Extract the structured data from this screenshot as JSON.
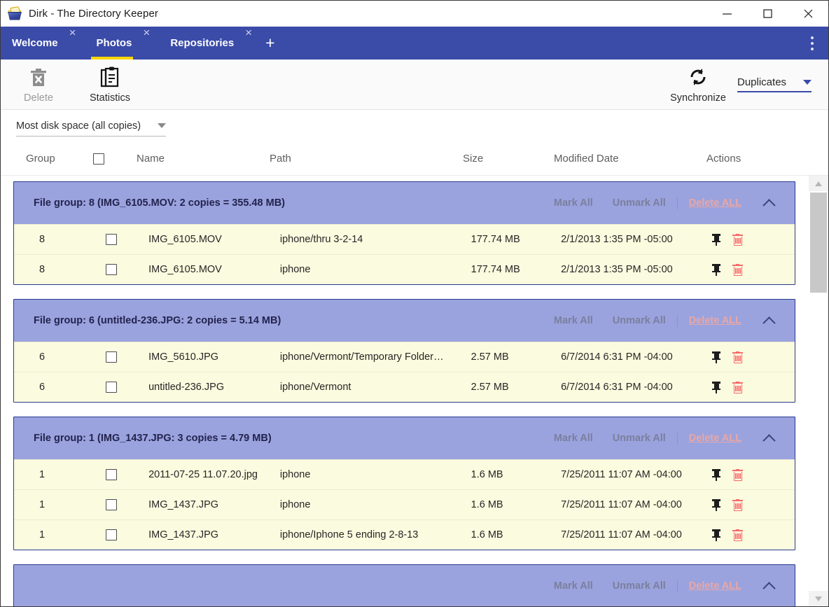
{
  "window": {
    "title": "Dirk - The Directory Keeper",
    "app_icon": "basket-icon",
    "controls": {
      "minimize": "minimize-icon",
      "maximize": "maximize-icon",
      "close": "close-icon"
    }
  },
  "tabs": {
    "items": [
      {
        "label": "Welcome",
        "active": false,
        "close": "×"
      },
      {
        "label": "Photos",
        "active": true,
        "close": "×"
      },
      {
        "label": "Repositories",
        "active": false,
        "close": "×"
      }
    ],
    "add_label": "+",
    "overflow_menu": "kebab-menu-icon",
    "active_underline_color": "#ffd600",
    "bar_color": "#3a4ba8"
  },
  "toolbar": {
    "delete_label": "Delete",
    "delete_icon": "trash-icon",
    "delete_disabled": true,
    "statistics_label": "Statistics",
    "statistics_icon": "clipboard-icon",
    "synchronize_label": "Synchronize",
    "synchronize_icon": "refresh-icon",
    "view_dropdown": {
      "value": "Duplicates",
      "caret": "chevron-down-icon",
      "accent": "#3a4ba8"
    }
  },
  "sort": {
    "value": "Most disk space (all copies)",
    "caret": "chevron-down-icon"
  },
  "table": {
    "columns": [
      "Group",
      "",
      "Name",
      "Path",
      "Size",
      "Modified Date",
      "Actions"
    ],
    "select_all_checkbox": "checkbox-unchecked"
  },
  "group_actions": {
    "mark_all": "Mark All",
    "unmark_all": "Unmark All",
    "delete_all": "Delete ALL",
    "collapse_icon": "chevron-up-icon"
  },
  "row_actions": {
    "pin": "pin-icon",
    "delete": "trash-icon"
  },
  "groups": [
    {
      "header": "File group: 8 (IMG_6105.MOV: 2 copies = 355.48 MB)",
      "rows": [
        {
          "group": "8",
          "checked": false,
          "name": "IMG_6105.MOV",
          "path": "iphone/thru 3-2-14",
          "size": "177.74 MB",
          "modified": "2/1/2013 1:35 PM -05:00"
        },
        {
          "group": "8",
          "checked": false,
          "name": "IMG_6105.MOV",
          "path": "iphone",
          "size": "177.74 MB",
          "modified": "2/1/2013 1:35 PM -05:00"
        }
      ]
    },
    {
      "header": "File group: 6 (untitled-236.JPG: 2 copies = 5.14 MB)",
      "rows": [
        {
          "group": "6",
          "checked": false,
          "name": "IMG_5610.JPG",
          "path": "iphone/Vermont/Temporary Folder…",
          "size": "2.57 MB",
          "modified": "6/7/2014 6:31 PM -04:00"
        },
        {
          "group": "6",
          "checked": false,
          "name": "untitled-236.JPG",
          "path": "iphone/Vermont",
          "size": "2.57 MB",
          "modified": "6/7/2014 6:31 PM -04:00"
        }
      ]
    },
    {
      "header": "File group: 1 (IMG_1437.JPG: 3 copies = 4.79 MB)",
      "rows": [
        {
          "group": "1",
          "checked": false,
          "name": "2011-07-25 11.07.20.jpg",
          "path": "iphone",
          "size": "1.6 MB",
          "modified": "7/25/2011 11:07 AM -04:00"
        },
        {
          "group": "1",
          "checked": false,
          "name": "IMG_1437.JPG",
          "path": "iphone",
          "size": "1.6 MB",
          "modified": "7/25/2011 11:07 AM -04:00"
        },
        {
          "group": "1",
          "checked": false,
          "name": "IMG_1437.JPG",
          "path": "iphone/Iphone 5 ending 2-8-13",
          "size": "1.6 MB",
          "modified": "7/25/2011 11:07 AM -04:00"
        }
      ]
    },
    {
      "header": "",
      "rows": []
    }
  ],
  "scrollbar": {
    "up_arrow": "scroll-up-icon",
    "down_arrow": "scroll-down-icon",
    "thumb": "scroll-thumb"
  },
  "colors": {
    "tab_bar": "#3a4ba8",
    "group_header": "#9aa3de",
    "row_background": "#fbfbdf",
    "delete_all": "#e8a7a7",
    "trash_red": "#f86a6a"
  }
}
